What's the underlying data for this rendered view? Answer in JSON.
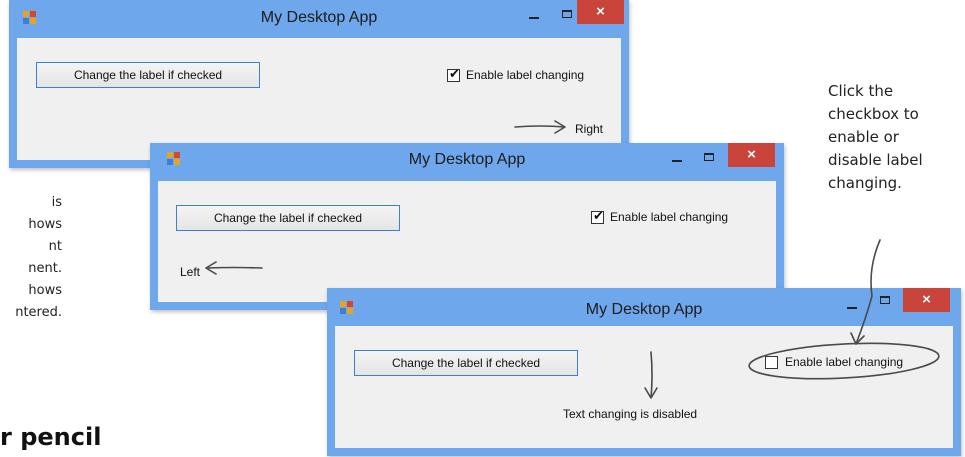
{
  "app_title": "My Desktop App",
  "window_controls": {
    "minimize": "–",
    "maximize": "□",
    "close": "×"
  },
  "colors": {
    "frame": "#6ea7ec",
    "close": "#c9453b",
    "client": "#f0f0f0"
  },
  "windows": [
    {
      "button_label": "Change the label if checked",
      "checkbox_label": "Enable label changing",
      "checked": true,
      "status_label": "Right"
    },
    {
      "button_label": "Change the label if checked",
      "checkbox_label": "Enable label changing",
      "checked": true,
      "status_label": "Left"
    },
    {
      "button_label": "Change the label if checked",
      "checkbox_label": "Enable label changing",
      "checked": false,
      "status_label": "Text changing is disabled"
    }
  ],
  "annotations": {
    "right_note": [
      "Click the",
      "checkbox to",
      "enable or",
      "disable label",
      "changing."
    ],
    "left_note_fragments": [
      "is",
      "hows",
      "nt",
      "nent.",
      "hows",
      "ntered."
    ],
    "bottom_fragment": "r pencil"
  }
}
